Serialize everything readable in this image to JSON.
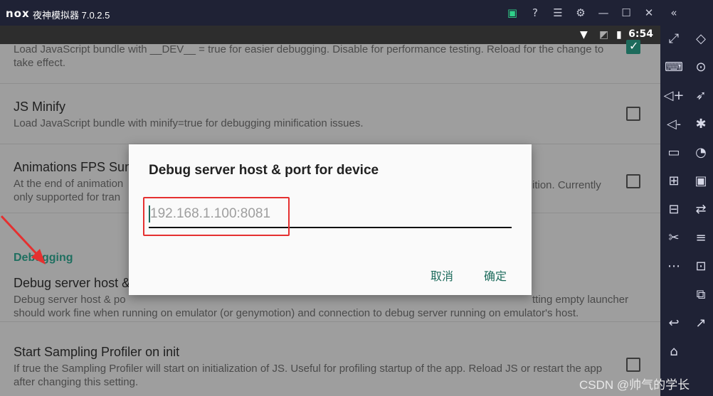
{
  "titlebar": {
    "logo": "nox",
    "app_title": "夜神模拟器 7.0.2.5",
    "icons": [
      "shop-icon",
      "help-icon",
      "menu-icon",
      "settings-icon",
      "minimize-icon",
      "maximize-icon",
      "close-icon",
      "collapse-icon"
    ]
  },
  "status": {
    "time": "6:54"
  },
  "settings": {
    "item0": {
      "desc": "Load JavaScript bundle with __DEV__ = true for easier debugging. Disable for performance testing. Reload for the change to take effect.",
      "checked": true
    },
    "item1": {
      "title": "JS Minify",
      "desc": "Load JavaScript bundle with minify=true for debugging minification issues.",
      "checked": false
    },
    "item2": {
      "title_left": "Animations FPS Sum",
      "desc_left": "At the end of animation",
      "desc_left2": "only supported for tran",
      "desc_right": "ition. Currently",
      "checked": false
    },
    "section": "Debugging",
    "item3": {
      "title_left": "Debug server host &",
      "desc_left": "Debug server host & po",
      "desc_right": "tting empty launcher",
      "desc2": "should work fine when running on emulator (or genymotion) and connection to debug server running on emulator's host."
    },
    "item4": {
      "title": "Start Sampling Profiler on init",
      "desc": "If true the Sampling Profiler will start on initialization of JS. Useful for profiling startup of the app. Reload JS or restart the app after changing this setting.",
      "checked": false
    }
  },
  "dialog": {
    "title": "Debug server host & port for device",
    "placeholder": "192.168.1.100:8081",
    "value": "",
    "cancel": "取消",
    "confirm": "确定"
  },
  "sidebar": {
    "left_icons": [
      "fullscreen-icon",
      "keyboard-icon",
      "volume-up-icon",
      "volume-down-icon",
      "screen-icon",
      "add-apk-icon",
      "toolbox-icon",
      "scissors-icon",
      "more-icon",
      "back-icon",
      "home-icon"
    ],
    "right_icons": [
      "rotate-icon",
      "location-icon",
      "rocket-icon",
      "loading-icon",
      "record-icon",
      "video-record-icon",
      "sync-icon",
      "list-icon",
      "screenshot-icon",
      "multi-window-icon",
      "external-icon"
    ]
  },
  "watermark": "CSDN @帅气的学长",
  "colors": {
    "accent": "#1d6b5c",
    "highlight": "#e53030",
    "frame": "#1f2235"
  }
}
